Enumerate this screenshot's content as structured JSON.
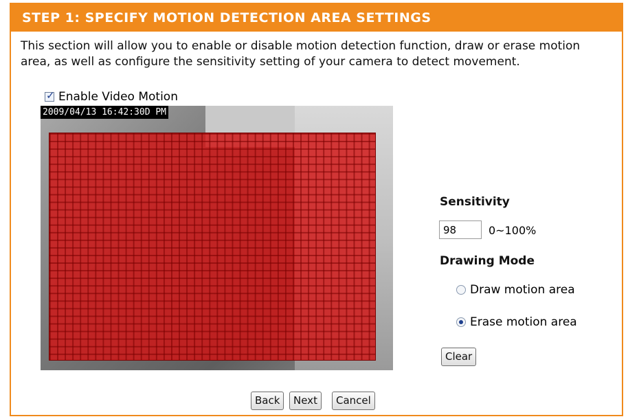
{
  "header": {
    "title": "STEP 1: SPECIFY MOTION DETECTION AREA SETTINGS"
  },
  "description": "This section will allow you to enable or disable motion detection function, draw or erase motion area, as well as configure the sensitivity setting of your camera to detect movement.",
  "enable_video_motion": {
    "label": "Enable Video Motion",
    "checked": true
  },
  "video": {
    "timestamp": "2009/04/13 16:42:30D PM"
  },
  "sensitivity": {
    "label": "Sensitivity",
    "value": "98",
    "range": "0~100%"
  },
  "drawing_mode": {
    "label": "Drawing Mode",
    "options": [
      {
        "label": "Draw motion area",
        "selected": false
      },
      {
        "label": "Erase motion area",
        "selected": true
      }
    ]
  },
  "buttons": {
    "clear": "Clear",
    "back": "Back",
    "next": "Next",
    "cancel": "Cancel"
  },
  "colors": {
    "header": "#f08a1c",
    "motion_grid": "#d21414"
  }
}
